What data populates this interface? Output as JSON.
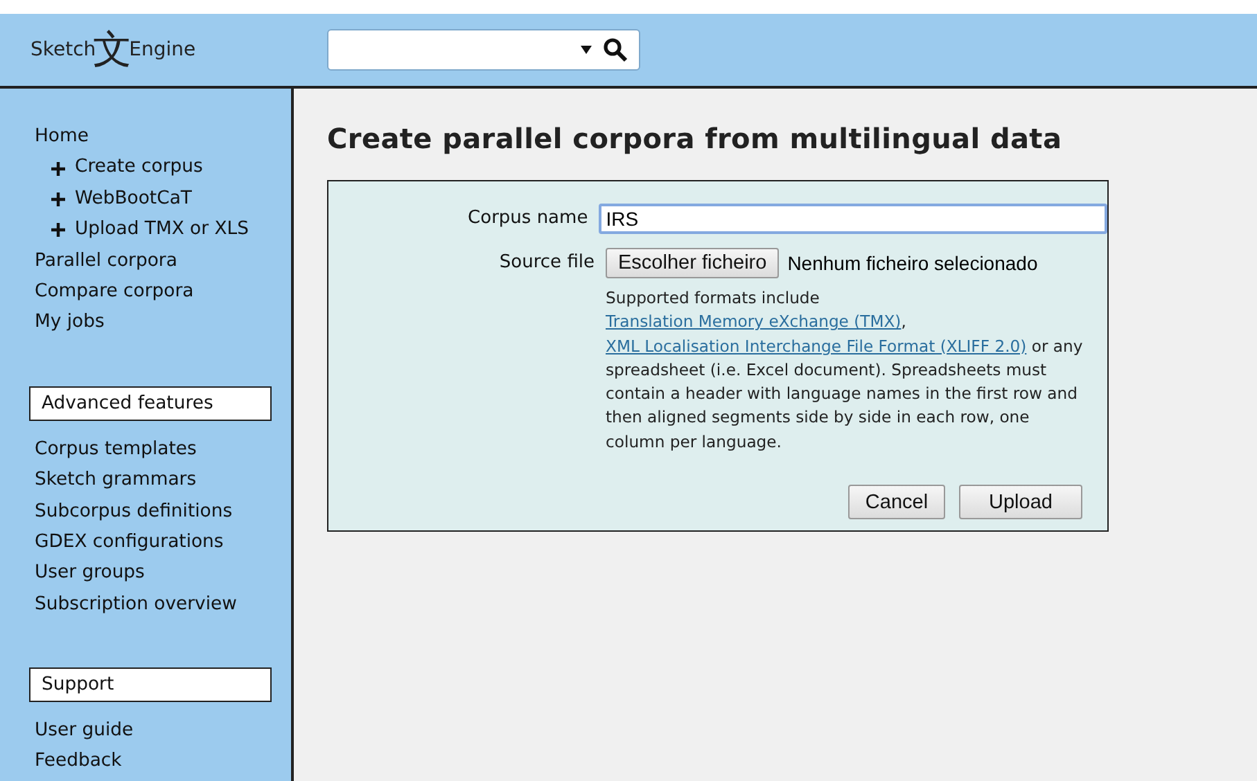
{
  "logo": {
    "left": "Sketch",
    "glyph": "文",
    "right": "Engine"
  },
  "sidebar": {
    "items": [
      {
        "label": "Home",
        "children": [
          {
            "label": "Create corpus"
          },
          {
            "label": "WebBootCaT"
          },
          {
            "label": "Upload TMX or XLS"
          }
        ]
      },
      {
        "label": "Parallel corpora"
      },
      {
        "label": "Compare corpora"
      },
      {
        "label": "My jobs"
      }
    ],
    "sections": [
      {
        "title": "Advanced features",
        "items": [
          {
            "label": "Corpus templates"
          },
          {
            "label": "Sketch grammars"
          },
          {
            "label": "Subcorpus definitions"
          },
          {
            "label": "GDEX configurations"
          },
          {
            "label": "User groups"
          },
          {
            "label": "Subscription overview"
          }
        ]
      },
      {
        "title": "Support",
        "items": [
          {
            "label": "User guide"
          },
          {
            "label": "Feedback"
          }
        ]
      }
    ]
  },
  "page_title": "Create parallel corpora from multilingual data",
  "form": {
    "corpus_name": {
      "label": "Corpus name",
      "value": "IRS"
    },
    "source_file": {
      "label": "Source file",
      "button": "Escolher ficheiro",
      "status": "Nenhum ficheiro selecionado"
    },
    "help": [
      {
        "kind": "text",
        "text": "Supported formats include "
      },
      {
        "kind": "link",
        "text": "Translation Memory eXchange (TMX)"
      },
      {
        "kind": "text",
        "text": ", "
      },
      {
        "kind": "link",
        "text": "XML Localisation Interchange File Format (XLIFF 2.0)"
      },
      {
        "kind": "text",
        "text": " or any spreadsheet (i.e. Excel document). Spreadsheets must contain a header with language names in the first row and then aligned segments side by side in each row, one column per language."
      }
    ],
    "buttons": [
      "Cancel",
      "Upload"
    ]
  }
}
